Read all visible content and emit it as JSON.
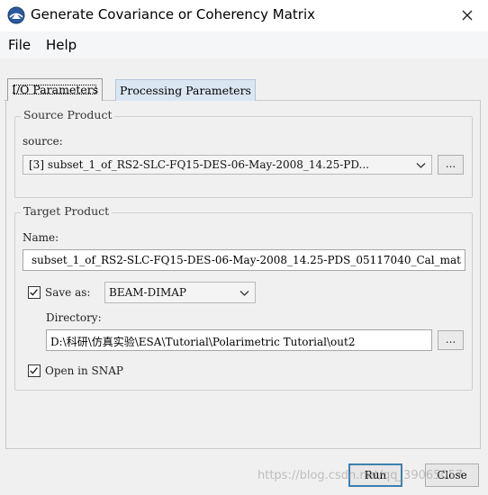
{
  "window": {
    "title": "Generate Covariance or Coherency Matrix"
  },
  "menu": {
    "items": [
      "File",
      "Help"
    ]
  },
  "tabs": [
    {
      "label": "I/O Parameters",
      "active": true
    },
    {
      "label": "Processing Parameters",
      "active": false
    }
  ],
  "source_product": {
    "group_title": "Source Product",
    "source_label": "source:",
    "selected": "[3] subset_1_of_RS2-SLC-FQ15-DES-06-May-2008_14.25-PD...",
    "browse_label": "..."
  },
  "target_product": {
    "group_title": "Target Product",
    "name_label": "Name:",
    "name_value": "subset_1_of_RS2-SLC-FQ15-DES-06-May-2008_14.25-PDS_05117040_Cal_mat",
    "save_as_label": "Save as:",
    "save_as_checked": true,
    "format": "BEAM-DIMAP",
    "directory_label": "Directory:",
    "directory_value": "D:\\科研\\仿真实验\\ESA\\Tutorial\\Polarimetric Tutorial\\out2",
    "browse_label": "...",
    "open_in_snap_label": "Open in SNAP",
    "open_in_snap_checked": true
  },
  "buttons": {
    "run": "Run",
    "close": "Close"
  },
  "watermark": "https://blog.csdn.net/qq_39065057",
  "colors": {
    "accent": "#3c7fb1",
    "inactive_tab": "#dbe6f3"
  }
}
